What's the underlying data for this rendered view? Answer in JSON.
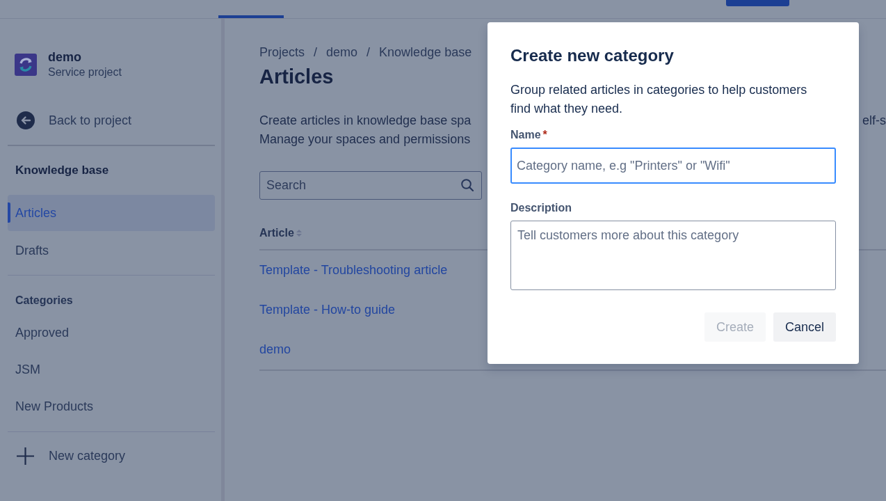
{
  "top_bar": {
    "tabs": [
      {
        "selected": true
      }
    ]
  },
  "sidebar": {
    "project": {
      "name": "demo",
      "type": "Service project"
    },
    "back_link": "Back to project",
    "section_title": "Knowledge base",
    "nav_items": [
      {
        "label": "Articles",
        "selected": true
      },
      {
        "label": "Drafts",
        "selected": false
      }
    ],
    "categories_title": "Categories",
    "categories": [
      {
        "label": "Approved",
        "selected": false
      },
      {
        "label": "JSM",
        "selected": false
      },
      {
        "label": "New Products",
        "selected": false
      }
    ],
    "new_category": "New category"
  },
  "breadcrumbs": [
    {
      "label": "Projects",
      "separator": "/"
    },
    {
      "label": "demo",
      "separator": "/"
    },
    {
      "label": "Knowledge base"
    }
  ],
  "page_title": "Articles",
  "intro_lines": [
    {
      "text": "Create articles in knowledge base spa",
      "text_right": "elf-s"
    },
    {
      "text": "Manage your spaces and permissions"
    }
  ],
  "search": {
    "placeholder": "Search"
  },
  "table": {
    "columns": [
      {
        "label": "Article",
        "sortable": true
      }
    ],
    "rows": [
      {
        "title": "Template - Troubleshooting article"
      },
      {
        "title": "Template - How-to guide"
      },
      {
        "title": "demo"
      }
    ]
  },
  "dialog": {
    "title": "Create new category",
    "description": "Group related articles in categories to help customers find what they need.",
    "fields": [
      {
        "kind": "input",
        "label": "Name",
        "required_mark": "*",
        "placeholder": "Category name, e.g \"Printers\" or \"Wifi\"",
        "focused": true
      },
      {
        "kind": "textarea",
        "label": "Description",
        "placeholder": "Tell customers more about this category",
        "focused": false
      }
    ],
    "buttons": [
      {
        "kind": "primary",
        "label": "Create",
        "disabled": true
      },
      {
        "kind": "secondary",
        "label": "Cancel",
        "disabled": false
      }
    ]
  }
}
